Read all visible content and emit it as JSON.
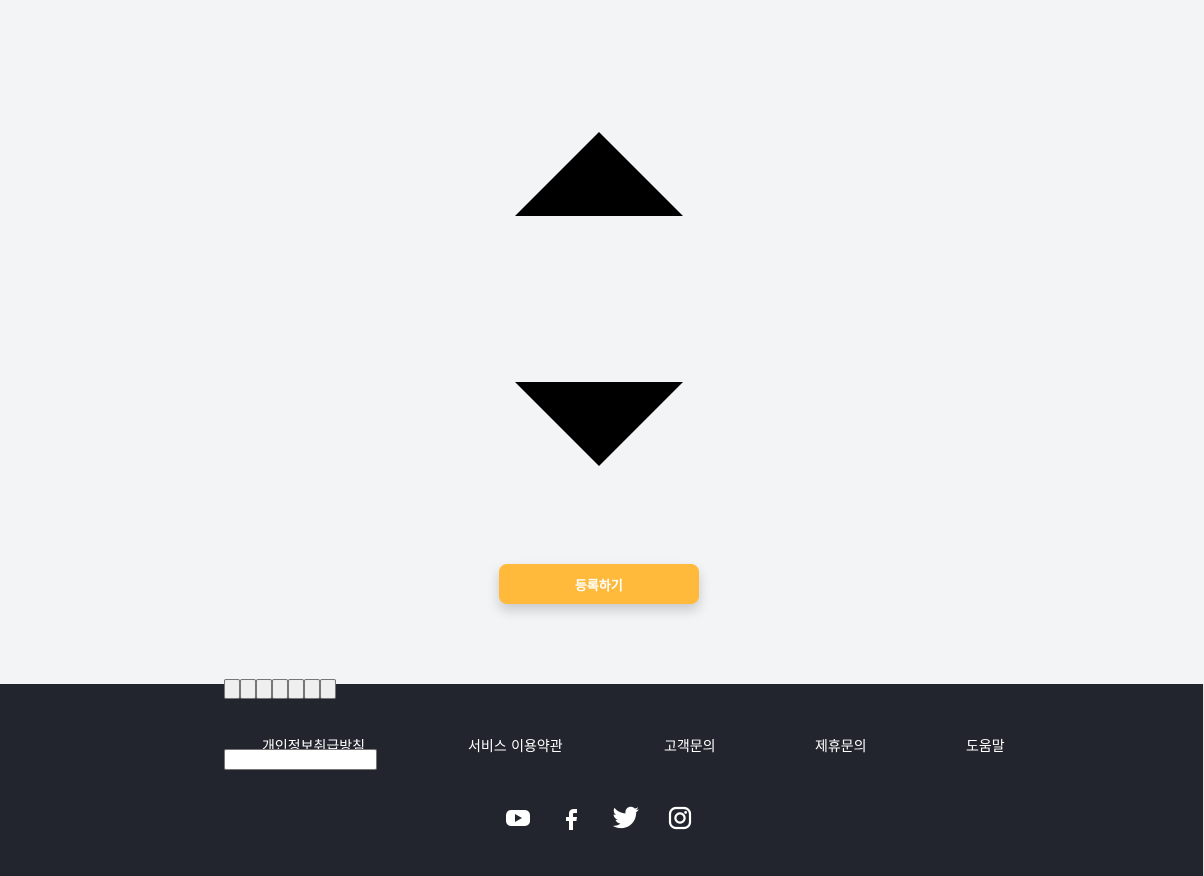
{
  "main": {
    "controls": {
      "up_icon": "triangle-up-icon",
      "down_icon": "triangle-down-icon"
    },
    "register_button": {
      "label": "등록하기",
      "color": "#ffba3b"
    }
  },
  "footer": {
    "background": "#22252d",
    "button_count": 7,
    "input": {
      "value": "",
      "placeholder": ""
    },
    "links": [
      "개인정보취급방침",
      "서비스 이용약관",
      "고객문의",
      "제휴문의",
      "도움말"
    ],
    "social": [
      "youtube-icon",
      "facebook-icon",
      "twitter-icon",
      "instagram-icon"
    ]
  }
}
